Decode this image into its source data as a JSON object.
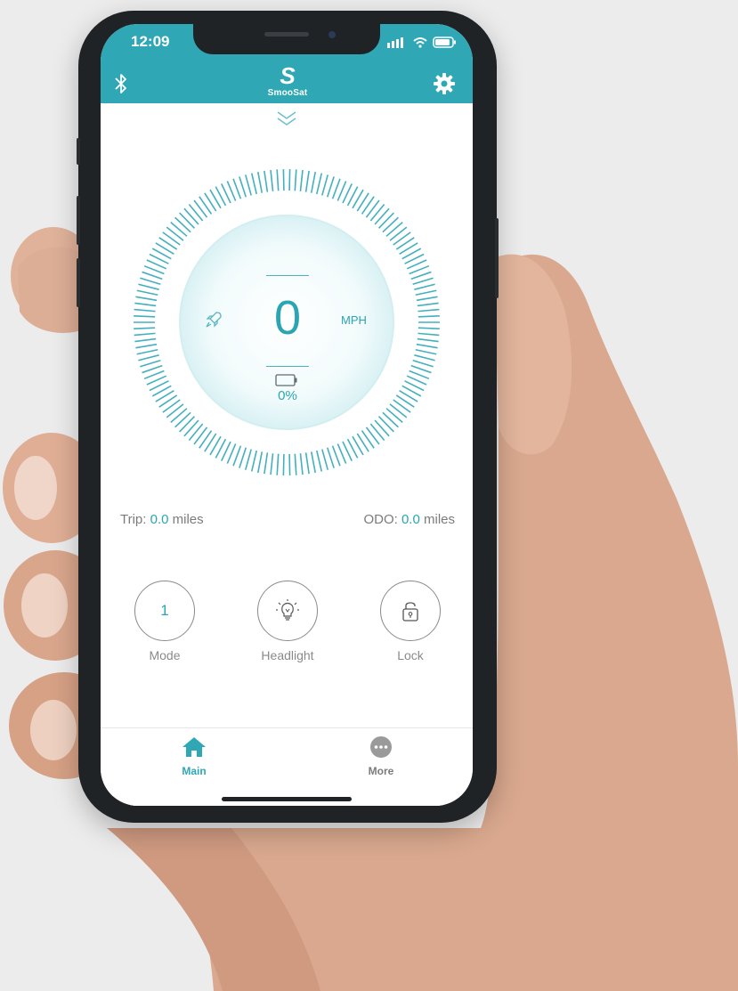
{
  "status_bar": {
    "time": "12:09"
  },
  "header": {
    "logo_letter": "S",
    "logo_text": "SmooSat"
  },
  "dashboard": {
    "speed": "0",
    "speed_unit": "MPH",
    "battery_percent": "0%"
  },
  "stats": {
    "trip_label": "Trip: ",
    "trip_value": "0.0",
    "trip_unit": " miles",
    "odo_label": "ODO: ",
    "odo_value": "0.0",
    "odo_unit": " miles"
  },
  "controls": [
    {
      "label": "Mode",
      "value": "1"
    },
    {
      "label": "Headlight",
      "icon": "lightbulb-icon"
    },
    {
      "label": "Lock",
      "icon": "lock-icon"
    }
  ],
  "tabs": [
    {
      "label": "Main",
      "icon": "home-icon",
      "active": true
    },
    {
      "label": "More",
      "icon": "more-icon",
      "active": false
    }
  ],
  "colors": {
    "accent": "#2fa7b5",
    "background": "#ececec",
    "text_muted": "#7b7b7b"
  }
}
